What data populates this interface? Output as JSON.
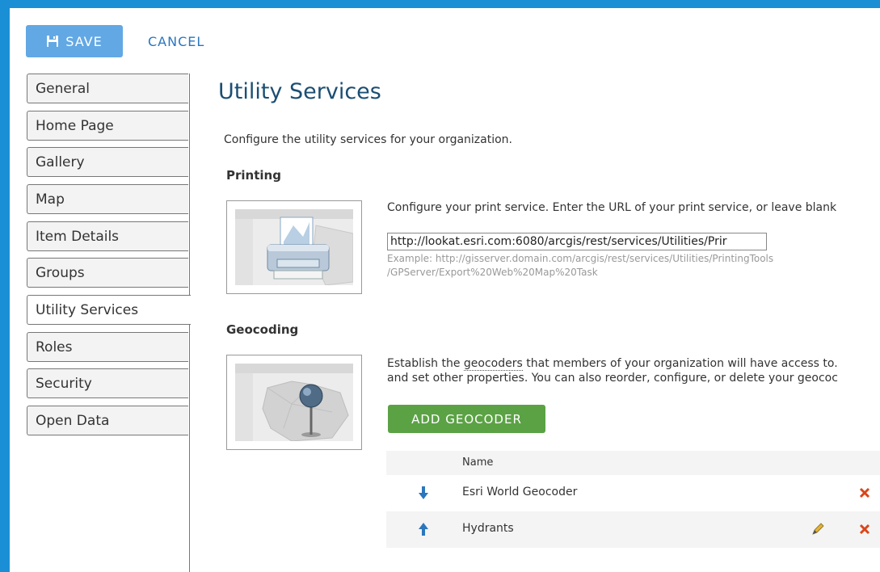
{
  "toolbar": {
    "save_label": "SAVE",
    "cancel_label": "CANCEL"
  },
  "sidebar": {
    "items": [
      {
        "label": "General"
      },
      {
        "label": "Home Page"
      },
      {
        "label": "Gallery"
      },
      {
        "label": "Map"
      },
      {
        "label": "Item Details"
      },
      {
        "label": "Groups"
      },
      {
        "label": "Utility Services",
        "active": true
      },
      {
        "label": "Roles"
      },
      {
        "label": "Security"
      },
      {
        "label": "Open Data"
      }
    ]
  },
  "main": {
    "title": "Utility Services",
    "intro": "Configure the utility services for your organization.",
    "printing": {
      "heading": "Printing",
      "description": "Configure your print service. Enter the URL of your print service, or leave blank",
      "url_value": "http://lookat.esri.com:6080/arcgis/rest/services/Utilities/Prir",
      "example_line1": "Example: http://gisserver.domain.com/arcgis/rest/services/Utilities/PrintingTools",
      "example_line2": "/GPServer/Export%20Web%20Map%20Task"
    },
    "geocoding": {
      "heading": "Geocoding",
      "desc_part1": "Establish the ",
      "desc_link": "geocoders",
      "desc_part2": " that members of your organization will have access to.",
      "desc_line2": "and set other properties. You can also reorder, configure, or delete your geococ",
      "add_label": "ADD GEOCODER",
      "column_name": "Name",
      "rows": [
        {
          "name": "Esri World Geocoder",
          "order_icon": "arrow-down-icon",
          "editable": false
        },
        {
          "name": "Hydrants",
          "order_icon": "arrow-up-icon",
          "editable": true
        }
      ]
    }
  },
  "colors": {
    "accent": "#62a8e4",
    "link": "#2b76bd",
    "title": "#1b4e73",
    "add_button": "#5ba245",
    "delete": "#d9461a",
    "background": "#1a8fd6"
  }
}
